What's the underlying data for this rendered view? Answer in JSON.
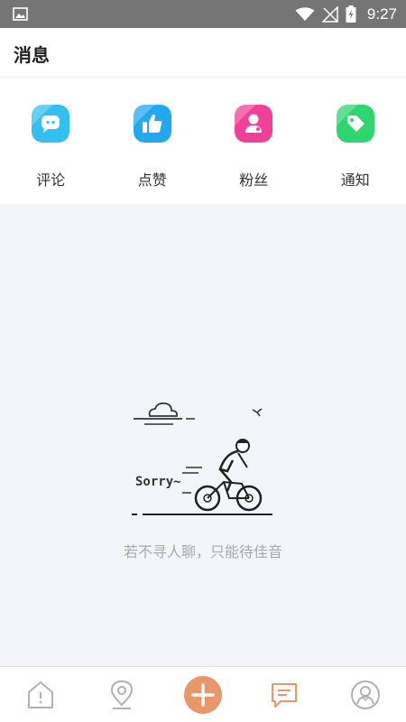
{
  "status_bar": {
    "time": "9:27",
    "icons": [
      "image-icon",
      "wifi-icon",
      "signal-icon",
      "battery-charging-icon"
    ]
  },
  "header": {
    "title": "消息"
  },
  "categories": [
    {
      "label": "评论",
      "icon": "chat-bubble-icon",
      "color": "#33bff2"
    },
    {
      "label": "点赞",
      "icon": "thumbs-up-icon",
      "color": "#22a8ee"
    },
    {
      "label": "粉丝",
      "icon": "person-icon",
      "color": "#f0409a"
    },
    {
      "label": "通知",
      "icon": "tag-icon",
      "color": "#2fd56f"
    }
  ],
  "empty_state": {
    "illustration_text": "Sorry~",
    "message": "若不寻人聊，只能待佳音",
    "illustration_icon": "cyclist-icon"
  },
  "tab_bar": {
    "items": [
      {
        "name": "home-tab",
        "icon": "home-icon",
        "active": false
      },
      {
        "name": "location-tab",
        "icon": "location-pin-icon",
        "active": false
      },
      {
        "name": "add-tab",
        "icon": "plus-icon",
        "active": false
      },
      {
        "name": "messages-tab",
        "icon": "message-icon",
        "active": true
      },
      {
        "name": "profile-tab",
        "icon": "profile-icon",
        "active": false
      }
    ],
    "accent_color": "#e8966a",
    "inactive_color": "#b0b0b8"
  }
}
